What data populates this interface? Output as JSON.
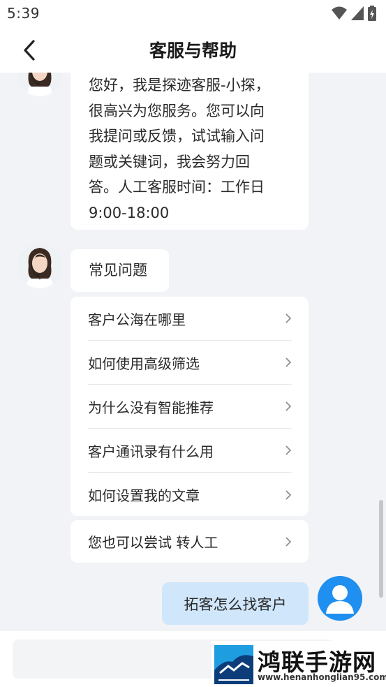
{
  "status_bar": {
    "time": "5:39"
  },
  "header": {
    "title": "客服与帮助"
  },
  "greeting": {
    "lines": [
      "您好，我是探迹客服-小探，",
      "很高兴为您服务。您可以向",
      "我提问或反馈，试试输入问",
      "题或关键词，我会努力回",
      "答。人工客服时间：工作日",
      "9:00-18:00"
    ]
  },
  "faq": {
    "title": "常见问题",
    "items": [
      "客户公海在哪里",
      "如何使用高级筛选",
      "为什么没有智能推荐",
      "客户通讯录有什么用",
      "如何设置我的文章"
    ]
  },
  "transfer": {
    "label": "您也可以尝试 转人工"
  },
  "user_message": {
    "text": "拓客怎么找客户"
  },
  "input": {
    "placeholder": "",
    "value": ""
  },
  "watermark": {
    "name": "鸿联手游网",
    "url": "www.henanhonglian95.com"
  },
  "colors": {
    "user_avatar": "#1f8ff0",
    "user_bubble": "#cfe6fb",
    "background": "#f2f3f7"
  }
}
